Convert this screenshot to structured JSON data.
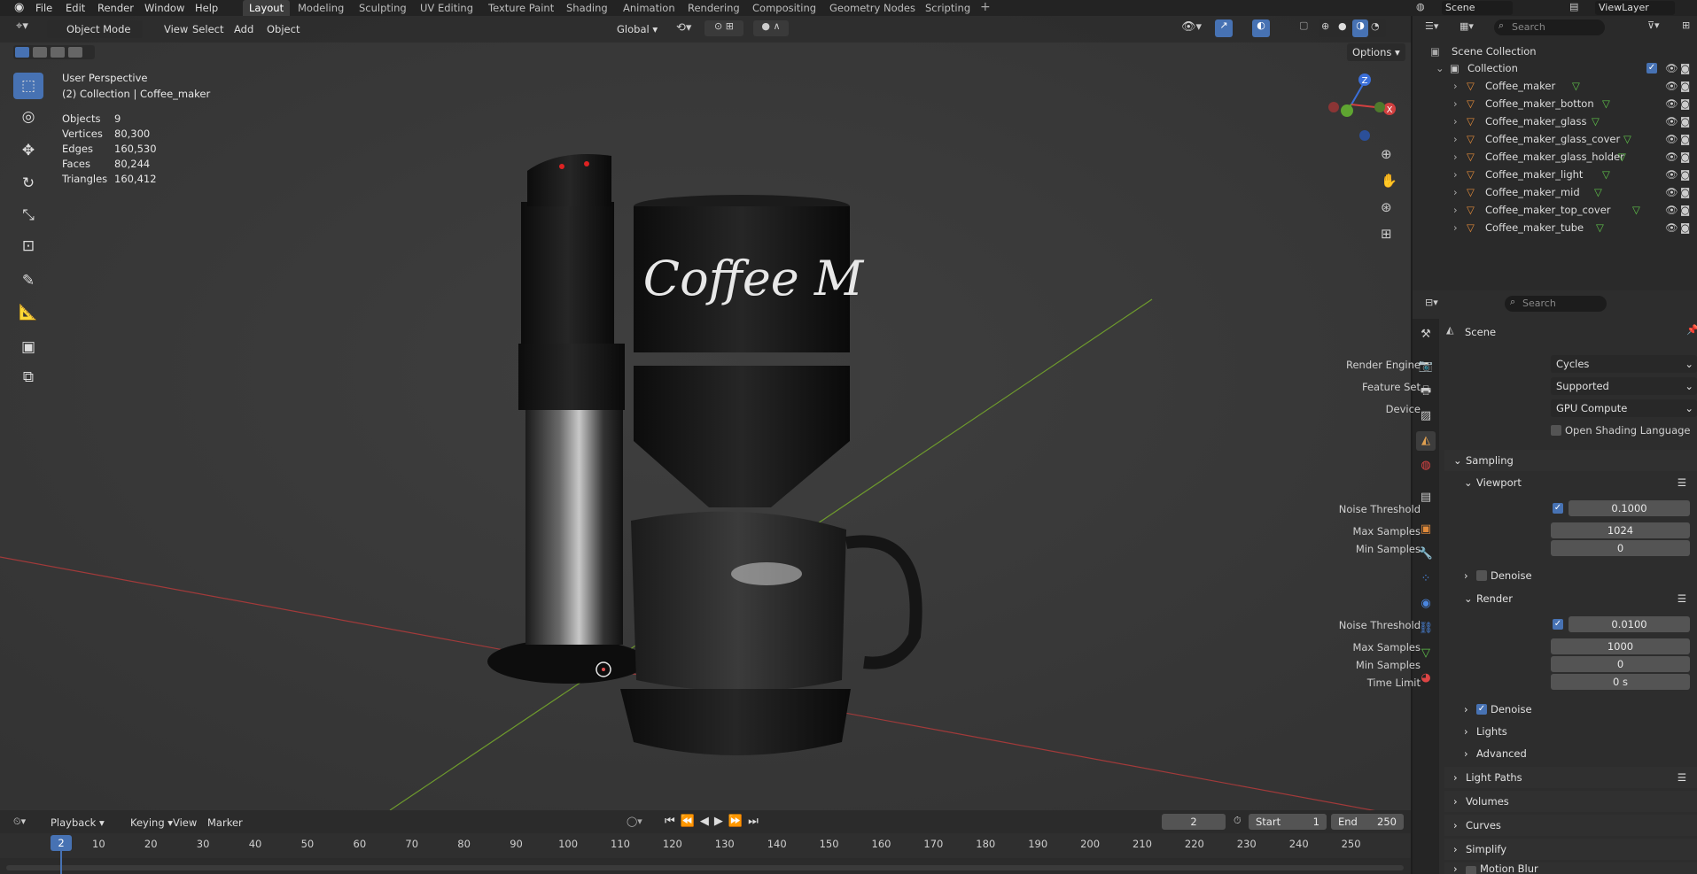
{
  "app": {
    "menus": [
      "File",
      "Edit",
      "Render",
      "Window",
      "Help"
    ],
    "workspaces": [
      "Layout",
      "Modeling",
      "Sculpting",
      "UV Editing",
      "Texture Paint",
      "Shading",
      "Animation",
      "Rendering",
      "Compositing",
      "Geometry Nodes",
      "Scripting"
    ],
    "scene_name": "Scene",
    "view_layer": "ViewLayer"
  },
  "viewport": {
    "mode": "Object Mode",
    "menus": [
      "View",
      "Select",
      "Add",
      "Object"
    ],
    "transform_orientation": "Global",
    "options_label": "Options",
    "overlay_title": "User Perspective",
    "overlay_subtitle": "(2) Collection | Coffee_maker",
    "stats": [
      {
        "label": "Objects",
        "value": "9"
      },
      {
        "label": "Vertices",
        "value": "80,300"
      },
      {
        "label": "Edges",
        "value": "160,530"
      },
      {
        "label": "Faces",
        "value": "80,244"
      },
      {
        "label": "Triangles",
        "value": "160,412"
      }
    ],
    "gizmo": {
      "z": "Z",
      "x": "X"
    },
    "model_text": "Coffee M"
  },
  "outliner": {
    "search_placeholder": "Search",
    "scene_collection": "Scene Collection",
    "collection": "Collection",
    "objects": [
      "Coffee_maker",
      "Coffee_maker_botton",
      "Coffee_maker_glass",
      "Coffee_maker_glass_cover",
      "Coffee_maker_glass_holder",
      "Coffee_maker_light",
      "Coffee_maker_mid",
      "Coffee_maker_top_cover",
      "Coffee_maker_tube"
    ]
  },
  "properties": {
    "search_placeholder": "Search",
    "context": "Scene",
    "render_engine_label": "Render Engine",
    "render_engine": "Cycles",
    "feature_set_label": "Feature Set",
    "feature_set": "Supported",
    "device_label": "Device",
    "device": "GPU Compute",
    "osl_label": "Open Shading Language",
    "sampling": "Sampling",
    "viewport": "Viewport",
    "noise_threshold_label": "Noise Threshold",
    "viewport_noise": "0.1000",
    "max_samples_label": "Max Samples",
    "viewport_max": "1024",
    "min_samples_label": "Min Samples",
    "viewport_min": "0",
    "denoise_label": "Denoise",
    "render": "Render",
    "render_noise": "0.0100",
    "render_max": "1000",
    "render_min": "0",
    "time_limit_label": "Time Limit",
    "time_limit": "0 s",
    "lights": "Lights",
    "advanced": "Advanced",
    "light_paths": "Light Paths",
    "volumes": "Volumes",
    "curves": "Curves",
    "simplify": "Simplify",
    "motion_blur": "Motion Blur"
  },
  "timeline": {
    "menus": [
      "Playback",
      "Keying",
      "View",
      "Marker"
    ],
    "current_frame": "2",
    "start_label": "Start",
    "start": "1",
    "end_label": "End",
    "end": "250",
    "ticks": [
      "10",
      "20",
      "30",
      "40",
      "50",
      "60",
      "70",
      "80",
      "90",
      "100",
      "110",
      "120",
      "130",
      "140",
      "150",
      "160",
      "170",
      "180",
      "190",
      "200",
      "210",
      "220",
      "230",
      "240",
      "250"
    ]
  }
}
